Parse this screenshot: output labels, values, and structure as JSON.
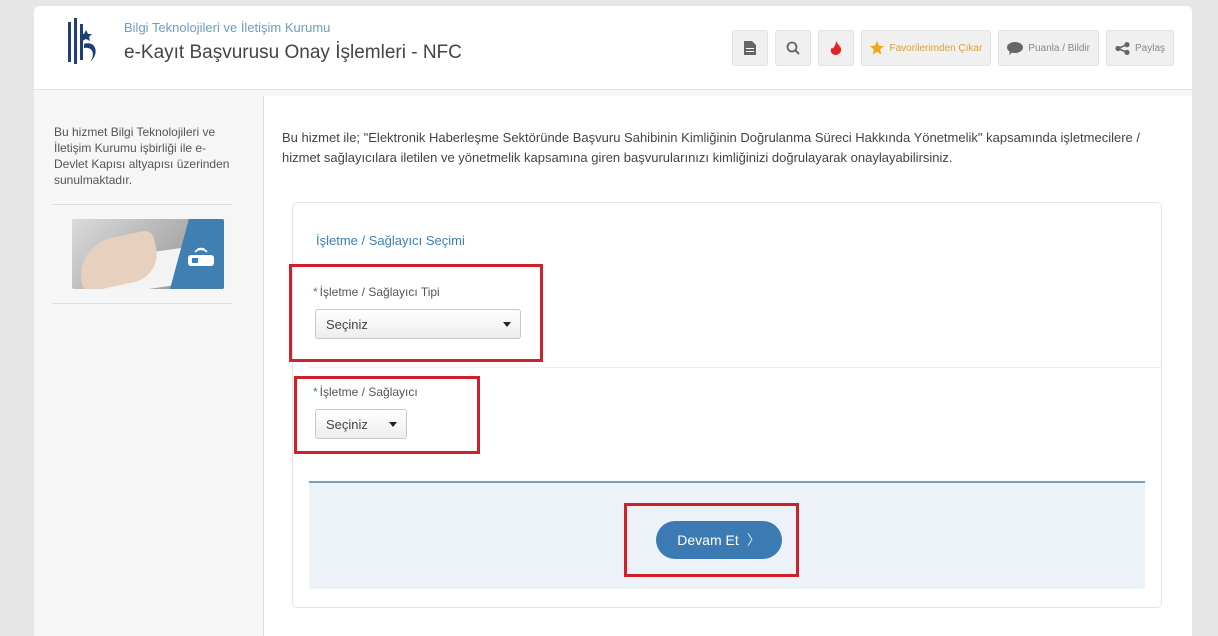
{
  "header": {
    "org_name": "Bilgi Teknolojileri ve İletişim Kurumu",
    "service_title": "e-Kayıt Başvurusu Onay İşlemleri - NFC",
    "tools": {
      "favorite_label": "Favorilerimden Çıkar",
      "rate_label": "Puanla / Bildir",
      "share_label": "Paylaş"
    }
  },
  "sidebar": {
    "description": "Bu hizmet Bilgi Teknolojileri ve İletişim Kurumu işbirliği ile e-Devlet Kapısı altyapısı üzerinden sunulmaktadır."
  },
  "main": {
    "intro": "Bu hizmet ile; \"Elektronik Haberleşme Sektöründe Başvuru Sahibinin Kimliğinin Doğrulanma Süreci Hakkında Yönetmelik\" kapsamında işletmecilere / hizmet sağlayıcılara iletilen ve yönetmelik kapsamına giren başvurularınızı kimliğinizi doğrulayarak onaylayabilirsiniz.",
    "form": {
      "section_title": "İşletme / Sağlayıcı Seçimi",
      "required_mark": "*",
      "provider_type_label": "İşletme / Sağlayıcı Tipi",
      "provider_type_value": "Seçiniz",
      "provider_label": "İşletme / Sağlayıcı",
      "provider_value": "Seçiniz",
      "continue_label": "Devam Et",
      "continue_chevron": "〉"
    }
  },
  "colors": {
    "accent": "#3c7ab3",
    "highlight": "#d0202a",
    "link": "#6a9ec4"
  },
  "icons": [
    "logo-icon",
    "document-icon",
    "search-icon",
    "fire-icon",
    "star-icon",
    "speech-bubble-icon",
    "share-icon",
    "nfc-icon",
    "caret-down-icon",
    "chevron-right-icon"
  ]
}
